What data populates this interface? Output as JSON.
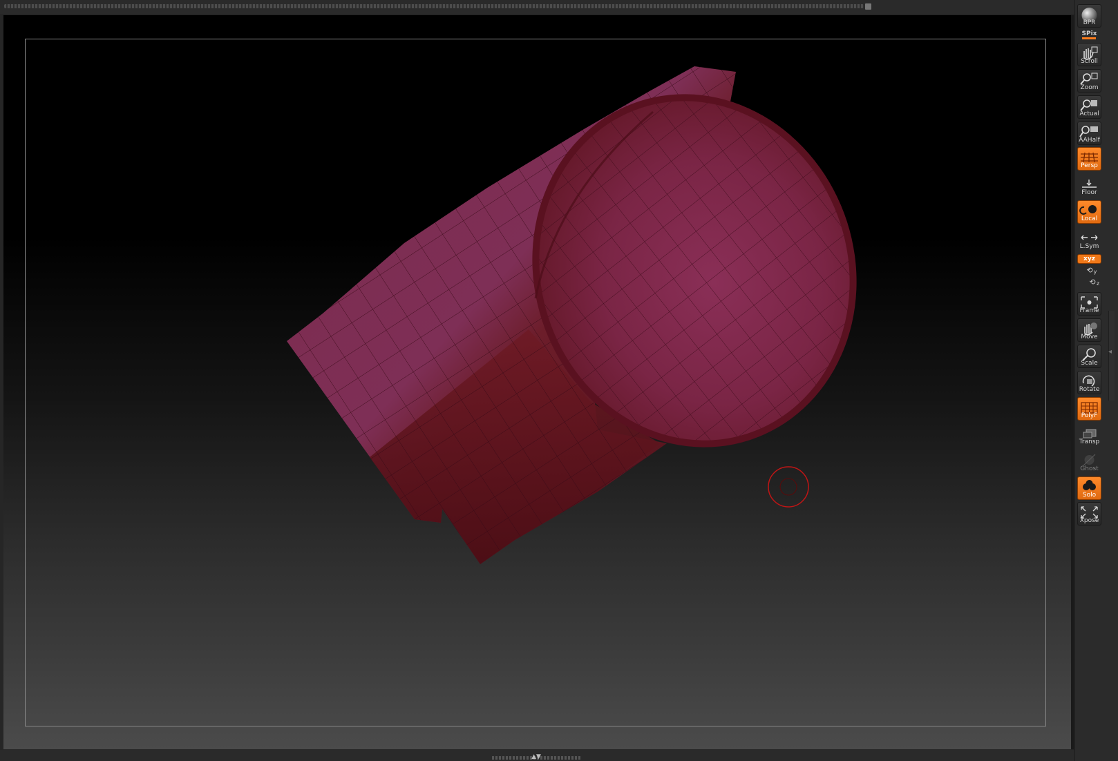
{
  "shelf": {
    "bpr_label": "BPR",
    "spix_label": "SPix",
    "tools": [
      {
        "id": "scroll",
        "label": "Scroll",
        "active": false,
        "icon": "hand-scroll-icon"
      },
      {
        "id": "zoom",
        "label": "Zoom",
        "active": false,
        "icon": "zoom-icon"
      },
      {
        "id": "actual",
        "label": "Actual",
        "active": false,
        "icon": "actual-size-icon"
      },
      {
        "id": "aahalf",
        "label": "AAHalf",
        "active": false,
        "icon": "aahalf-icon"
      },
      {
        "id": "persp",
        "label": "Persp",
        "active": true,
        "icon": "perspective-grid-icon"
      },
      {
        "id": "floor",
        "label": "Floor",
        "active": false,
        "icon": "floor-icon"
      },
      {
        "id": "local",
        "label": "Local",
        "active": true,
        "icon": "local-icon"
      },
      {
        "id": "lsym",
        "label": "L.Sym",
        "active": false,
        "icon": "lsym-icon"
      },
      {
        "id": "frame",
        "label": "Frame",
        "active": false,
        "icon": "frame-icon"
      },
      {
        "id": "move",
        "label": "Move",
        "active": false,
        "icon": "move-hand-icon"
      },
      {
        "id": "scale",
        "label": "Scale",
        "active": false,
        "icon": "scale-icon"
      },
      {
        "id": "rotate",
        "label": "Rotate",
        "active": false,
        "icon": "rotate-icon"
      },
      {
        "id": "polyf",
        "label": "PolyF",
        "active": true,
        "icon": "polyframe-icon"
      },
      {
        "id": "transp",
        "label": "Transp",
        "active": false,
        "icon": "transparency-icon"
      },
      {
        "id": "ghost",
        "label": "Ghost",
        "active": false,
        "icon": "ghost-icon"
      },
      {
        "id": "solo",
        "label": "Solo",
        "active": true,
        "icon": "solo-icon"
      },
      {
        "id": "xpose",
        "label": "Xpose",
        "active": false,
        "icon": "xpose-icon"
      }
    ],
    "xyz_label": "xyz",
    "y_axis_label": "y",
    "z_axis_label": "z"
  },
  "colors": {
    "accent": "#f07818",
    "mesh_dark": "#7a1a24",
    "mesh_light": "#8a2f55",
    "brush_cursor": "#c01515"
  }
}
